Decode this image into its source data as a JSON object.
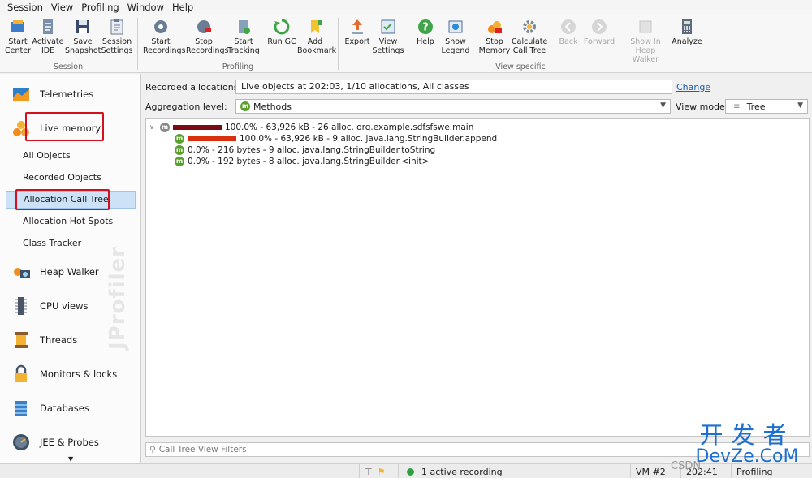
{
  "menu": [
    "Session",
    "View",
    "Profiling",
    "Window",
    "Help"
  ],
  "toolbar": {
    "session_group": "Session",
    "profiling_group": "Profiling",
    "view_group": "View specific",
    "buttons": {
      "start_center": [
        "Start",
        "Center"
      ],
      "activate_ide": [
        "Activate",
        "IDE"
      ],
      "save_snapshot": [
        "Save",
        "Snapshot"
      ],
      "session_settings": [
        "Session",
        "Settings"
      ],
      "start_recordings": [
        "Start",
        "Recordings"
      ],
      "stop_recordings": [
        "Stop",
        "Recordings"
      ],
      "start_tracking": [
        "Start",
        "Tracking"
      ],
      "run_gc": [
        "Run GC",
        ""
      ],
      "add_bookmark": [
        "Add",
        "Bookmark"
      ],
      "export": [
        "Export",
        ""
      ],
      "view_settings": [
        "View",
        "Settings"
      ],
      "help": [
        "Help",
        ""
      ],
      "show_legend": [
        "Show",
        "Legend"
      ],
      "stop_memory": [
        "Stop",
        "Memory"
      ],
      "calculate_call_tree": [
        "Calculate",
        "Call Tree"
      ],
      "back": [
        "Back",
        ""
      ],
      "forward": [
        "Forward",
        ""
      ],
      "show_in_heap_walker": [
        "Show In",
        "Heap Walker"
      ],
      "analyze": [
        "Analyze",
        ""
      ]
    }
  },
  "sidebar": {
    "telemetries": "Telemetries",
    "live_memory": "Live memory",
    "sub": [
      "All Objects",
      "Recorded Objects",
      "Allocation Call Tree",
      "Allocation Hot Spots",
      "Class Tracker"
    ],
    "heap_walker": "Heap Walker",
    "cpu_views": "CPU views",
    "threads": "Threads",
    "monitors": "Monitors & locks",
    "databases": "Databases",
    "jee": "JEE & Probes",
    "watermark": "JProfiler"
  },
  "main": {
    "recorded_label": "Recorded allocations:",
    "recorded_value": "Live objects at 202:03, 1/10 allocations, All classes",
    "change_link": "Change",
    "aggregation_label": "Aggregation level:",
    "aggregation_value": "Methods",
    "view_mode_label": "View mode:",
    "view_mode_value": "Tree",
    "tree": [
      {
        "text": "100.0% - 63,926 kB - 26 alloc. org.example.sdfsfswe.main",
        "fraction": 1.0,
        "bar_color": "#7a0b12",
        "icon_color": "#8a8a8a"
      },
      {
        "text": "100.0% - 63,926 kB - 9 alloc. java.lang.StringBuilder.append",
        "fraction": 1.0,
        "bar_color": "#d9300f",
        "icon_color": "#5aa02c"
      },
      {
        "text": "0.0% - 216 bytes - 9 alloc. java.lang.StringBuilder.toString",
        "fraction": 0.0,
        "bar_color": "#d9300f",
        "icon_color": "#5aa02c"
      },
      {
        "text": "0.0% - 192 bytes - 8 alloc. java.lang.StringBuilder.<init>",
        "fraction": 0.0,
        "bar_color": "#d9300f",
        "icon_color": "#5aa02c"
      }
    ],
    "filter_placeholder": "Call Tree View Filters"
  },
  "status": {
    "recording": "1 active recording",
    "vm": "VM #2",
    "time": "202:41",
    "mode": "Profiling"
  },
  "brand": {
    "cn": "开发者",
    "en": "DevZe.CoM",
    "csdn": "CSDN"
  }
}
